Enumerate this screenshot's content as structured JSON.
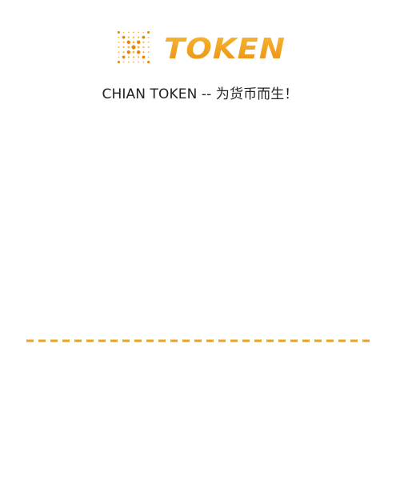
{
  "brand": {
    "logo_text": "TOKEN",
    "icon": "dot-burst-icon",
    "color_light": "#f7b733",
    "color_dark": "#e8860c"
  },
  "tagline": "CHIAN TOKEN -- 为货币而生！",
  "divider": {
    "style": "dashed",
    "color": "#f0a020"
  }
}
